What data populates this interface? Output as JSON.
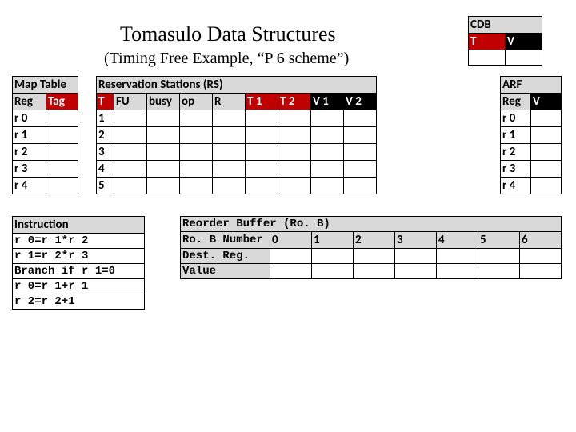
{
  "heading": "Tomasulo Data Structures",
  "subheading": "(Timing Free Example, “P 6 scheme”)",
  "cdb": {
    "title": "CDB",
    "col_t": "T",
    "col_v": "V",
    "t": "",
    "v": ""
  },
  "maptable": {
    "title": "Map Table",
    "col_reg": "Reg",
    "col_tag": "Tag",
    "rows": [
      {
        "reg": "r 0",
        "tag": ""
      },
      {
        "reg": "r 1",
        "tag": ""
      },
      {
        "reg": "r 2",
        "tag": ""
      },
      {
        "reg": "r 3",
        "tag": ""
      },
      {
        "reg": "r 4",
        "tag": ""
      }
    ]
  },
  "rs": {
    "title": "Reservation Stations (RS)",
    "cols": {
      "t": "T",
      "fu": "FU",
      "busy": "busy",
      "op": "op",
      "r": "R",
      "t1": "T 1",
      "t2": "T 2",
      "v1": "V 1",
      "v2": "V 2"
    },
    "rows": [
      {
        "id": "1",
        "fu": "",
        "busy": "",
        "op": "",
        "r": "",
        "t1": "",
        "t2": "",
        "v1": "",
        "v2": ""
      },
      {
        "id": "2",
        "fu": "",
        "busy": "",
        "op": "",
        "r": "",
        "t1": "",
        "t2": "",
        "v1": "",
        "v2": ""
      },
      {
        "id": "3",
        "fu": "",
        "busy": "",
        "op": "",
        "r": "",
        "t1": "",
        "t2": "",
        "v1": "",
        "v2": ""
      },
      {
        "id": "4",
        "fu": "",
        "busy": "",
        "op": "",
        "r": "",
        "t1": "",
        "t2": "",
        "v1": "",
        "v2": ""
      },
      {
        "id": "5",
        "fu": "",
        "busy": "",
        "op": "",
        "r": "",
        "t1": "",
        "t2": "",
        "v1": "",
        "v2": ""
      }
    ]
  },
  "arf": {
    "title": "ARF",
    "col_reg": "Reg",
    "col_v": "V",
    "rows": [
      {
        "reg": "r 0",
        "v": ""
      },
      {
        "reg": "r 1",
        "v": ""
      },
      {
        "reg": "r 2",
        "v": ""
      },
      {
        "reg": "r 3",
        "v": ""
      },
      {
        "reg": "r 4",
        "v": ""
      }
    ]
  },
  "instr": {
    "title": "Instruction",
    "rows": [
      "r 0=r 1*r 2",
      "r 1=r 2*r 3",
      "Branch if r 1=0",
      "r 0=r 1+r 1",
      "r 2=r 2+1"
    ]
  },
  "rob": {
    "title": "Reorder Buffer (Ro. B)",
    "row_num": "Ro. B Number",
    "row_dest": "Dest. Reg.",
    "row_val": "Value",
    "slots": [
      "0",
      "1",
      "2",
      "3",
      "4",
      "5",
      "6"
    ],
    "dest": [
      "",
      "",
      "",
      "",
      "",
      "",
      ""
    ],
    "val": [
      "",
      "",
      "",
      "",
      "",
      "",
      ""
    ]
  }
}
